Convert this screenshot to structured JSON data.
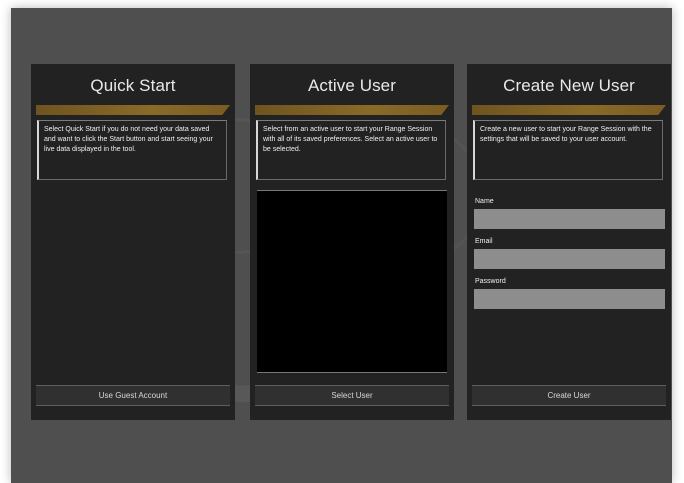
{
  "panels": {
    "quick_start": {
      "title": "Quick Start",
      "description": "Select Quick Start if you do not need your data saved and want to click the Start button and start seeing your live data displayed in the tool.",
      "button_label": "Use Guest Account"
    },
    "active_user": {
      "title": "Active User",
      "description": "Select from an active user to start your Range Session with all of its saved preferences. Select an active user to be selected.",
      "button_label": "Select User"
    },
    "create_user": {
      "title": "Create New User",
      "description": "Create a new user to start your Range Session with the settings that will be saved to your user account.",
      "fields": {
        "name_label": "Name",
        "email_label": "Email",
        "password_label": "Password"
      },
      "button_label": "Create User"
    }
  }
}
